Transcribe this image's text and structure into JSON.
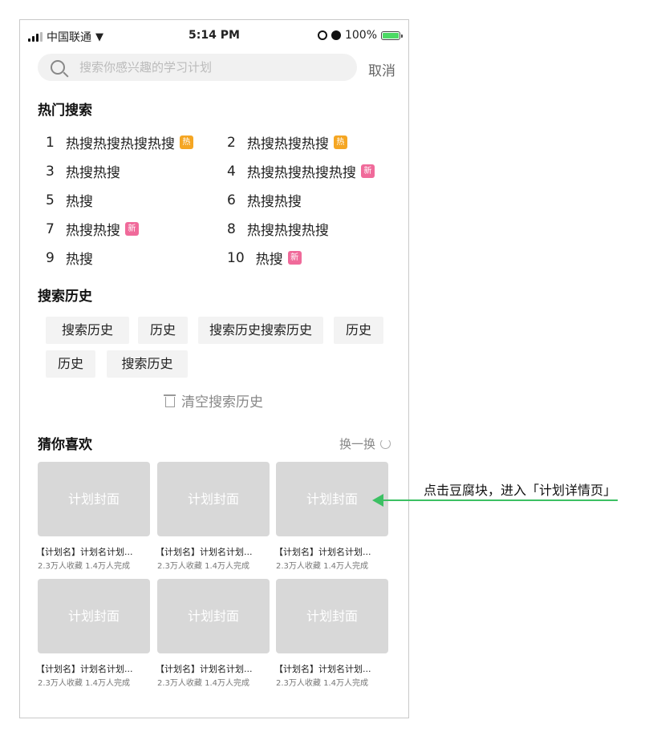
{
  "status_bar": {
    "carrier": "中国联通",
    "time": "5:14 PM",
    "battery": "100%"
  },
  "search": {
    "placeholder": "搜索你感兴趣的学习计划",
    "cancel_label": "取消"
  },
  "hot_search": {
    "title": "热门搜索",
    "items": [
      {
        "rank": "1",
        "text": "热搜热搜热搜热搜",
        "badge": "热",
        "badge_type": "hot"
      },
      {
        "rank": "2",
        "text": "热搜热搜热搜",
        "badge": "热",
        "badge_type": "hot"
      },
      {
        "rank": "3",
        "text": "热搜热搜",
        "badge": "",
        "badge_type": ""
      },
      {
        "rank": "4",
        "text": "热搜热搜热搜热搜",
        "badge": "新",
        "badge_type": "new"
      },
      {
        "rank": "5",
        "text": "热搜",
        "badge": "",
        "badge_type": ""
      },
      {
        "rank": "6",
        "text": "热搜热搜",
        "badge": "",
        "badge_type": ""
      },
      {
        "rank": "7",
        "text": "热搜热搜",
        "badge": "新",
        "badge_type": "new"
      },
      {
        "rank": "8",
        "text": "热搜热搜热搜",
        "badge": "",
        "badge_type": ""
      },
      {
        "rank": "9",
        "text": "热搜",
        "badge": "",
        "badge_type": ""
      },
      {
        "rank": "10",
        "text": "热搜",
        "badge": "新",
        "badge_type": "new"
      }
    ]
  },
  "history": {
    "title": "搜索历史",
    "chips": [
      "搜索历史",
      "历史",
      "搜索历史搜索历史",
      "历史",
      "历史",
      "搜索历史"
    ],
    "clear_label": "清空搜索历史"
  },
  "recommend": {
    "title": "猜你喜欢",
    "refresh_label": "换一换",
    "cards": [
      {
        "cover": "计划封面",
        "title": "【计划名】计划名计划...",
        "meta": "2.3万人收藏  1.4万人完成"
      },
      {
        "cover": "计划封面",
        "title": "【计划名】计划名计划...",
        "meta": "2.3万人收藏  1.4万人完成"
      },
      {
        "cover": "计划封面",
        "title": "【计划名】计划名计划...",
        "meta": "2.3万人收藏  1.4万人完成"
      },
      {
        "cover": "计划封面",
        "title": "【计划名】计划名计划...",
        "meta": "2.3万人收藏  1.4万人完成"
      },
      {
        "cover": "计划封面",
        "title": "【计划名】计划名计划...",
        "meta": "2.3万人收藏  1.4万人完成"
      },
      {
        "cover": "计划封面",
        "title": "【计划名】计划名计划...",
        "meta": "2.3万人收藏  1.4万人完成"
      }
    ]
  },
  "annotation": {
    "text": "点击豆腐块，进入「计划详情页」",
    "arrow_color": "#3cc063"
  },
  "colors": {
    "hot_badge": "#f5a623",
    "new_badge": "#f06a9a",
    "cover_bg": "#d8d8d8"
  }
}
